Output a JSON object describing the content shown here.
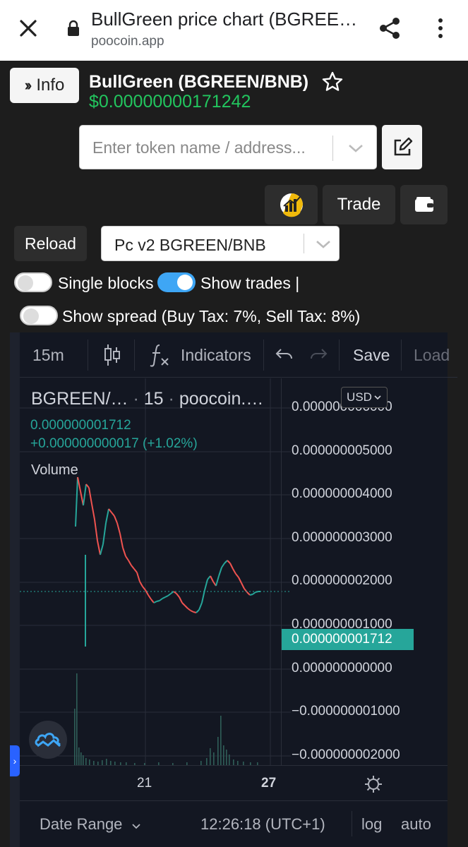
{
  "browser": {
    "title": "BullGreen price chart (BGREE…",
    "url": "poocoin.app"
  },
  "header": {
    "info_label": "Info",
    "token_name": "BullGreen (BGREEN/BNB)",
    "price": "$0.00000000171242"
  },
  "search": {
    "placeholder": "Enter token name / address..."
  },
  "actions": {
    "trade_label": "Trade"
  },
  "controls": {
    "reload_label": "Reload",
    "pair_value": "Pc v2 BGREEN/BNB",
    "single_blocks_label": "Single blocks",
    "single_blocks_on": false,
    "show_trades_label": "Show trades |",
    "show_trades_on": true,
    "show_spread_label": "Show spread (Buy Tax: 7%, Sell Tax: 8%)",
    "show_spread_on": false
  },
  "chart_toolbar": {
    "interval": "15m",
    "indicators_label": "Indicators",
    "save_label": "Save",
    "load_label": "Load"
  },
  "chart_legend": {
    "symbol": "BGREEN/…",
    "interval": "15",
    "source": "poocoin.…",
    "value": "0.000000001712",
    "change": "+0.000000000017 (+1.02%)",
    "volume_label": "Volume"
  },
  "price_axis": {
    "currency": "USD",
    "current_price": "0.000000001712",
    "ticks": [
      "0.000000006000",
      "0.000000005000",
      "0.000000004000",
      "0.000000003000",
      "0.000000002000",
      "0.000000001000",
      "0.000000000000",
      "−0.000000001000",
      "−0.000000002000"
    ]
  },
  "time_axis": {
    "ticks": [
      "21",
      "27"
    ]
  },
  "bottom_bar": {
    "date_range_label": "Date Range",
    "clock": "12:26:18 (UTC+1)",
    "log_label": "log",
    "auto_label": "auto"
  },
  "colors": {
    "up": "#26a69a",
    "down": "#ef5350",
    "price_green": "#22c55e",
    "toggle_on": "#3ea6f5"
  }
}
